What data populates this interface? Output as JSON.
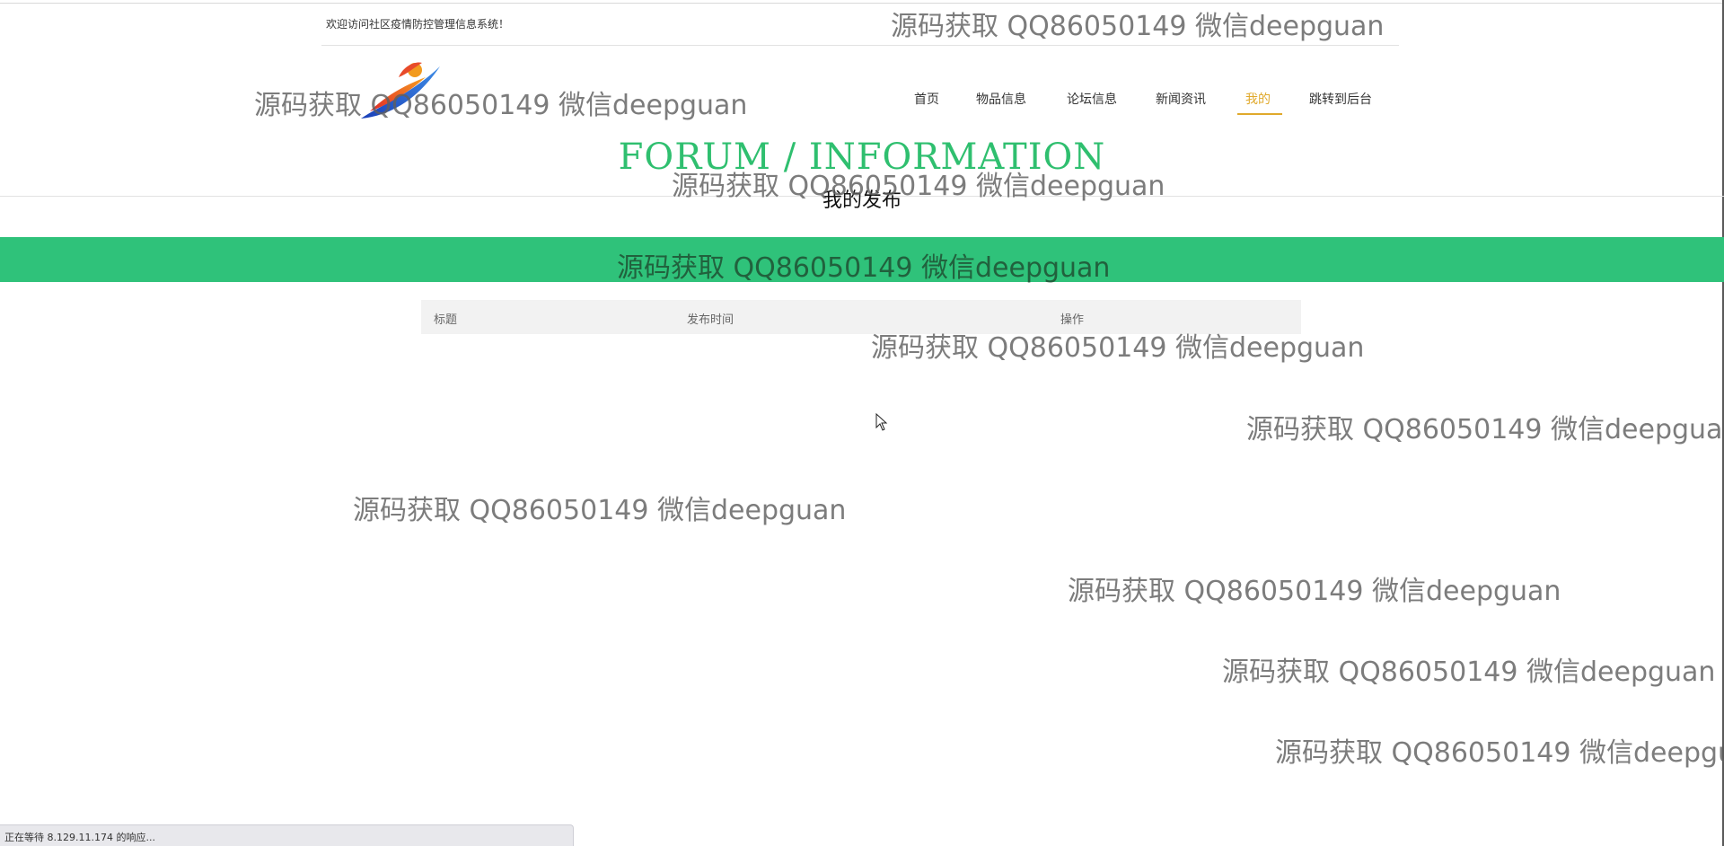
{
  "header": {
    "welcome_text": "欢迎访问社区疫情防控管理信息系统！"
  },
  "nav": {
    "items": [
      {
        "label": "首页"
      },
      {
        "label": "物品信息"
      },
      {
        "label": "论坛信息"
      },
      {
        "label": "新闻资讯"
      },
      {
        "label": "我的"
      },
      {
        "label": "跳转到后台"
      }
    ],
    "active_index": 4,
    "active_color": "#e0a92c"
  },
  "banner": {
    "title": "FORUM / INFORMATION",
    "subtitle": "我的发布",
    "title_color": "#2fbf6f",
    "band_color": "#2fc27a"
  },
  "table": {
    "columns": [
      "标题",
      "发布时间",
      "操作"
    ],
    "rows": []
  },
  "watermark": {
    "text": "源码获取 QQ86050149 微信deepguan"
  },
  "status_bar": {
    "text": "正在等待 8.129.11.174 的响应..."
  },
  "icons": {
    "logo": "logo-icon",
    "cursor": "mouse-cursor-icon"
  }
}
